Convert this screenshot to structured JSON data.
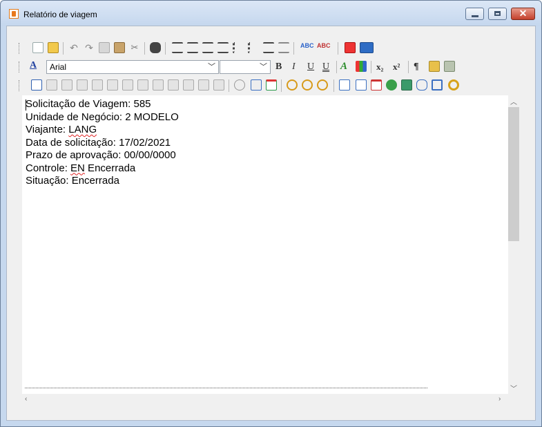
{
  "window": {
    "title": "Relatório de viagem"
  },
  "toolbar": {
    "font_name": "Arial",
    "font_size": "",
    "bold_label": "B",
    "italic_label": "I",
    "underline_label": "U",
    "double_underline_label": "U",
    "subscript_label": "x₂",
    "superscript_label": "x²",
    "paragraph_label": "¶"
  },
  "document": {
    "lines": [
      "Solicitação de Viagem: 585",
      "Unidade de Negócio: 2 MODELO",
      "Viajante: LANG",
      "Data de solicitação: 17/02/2021",
      "Prazo de aprovação: 00/00/0000",
      "Controle: EN Encerrada",
      "Situação: Encerrada"
    ],
    "viajante_label": "Viajante: ",
    "viajante_value": "LANG",
    "controle_label": "Controle: ",
    "controle_code": "EN",
    "controle_status": " Encerrada"
  },
  "colors": {
    "title_gradient_top": "#dbe7f6",
    "close_button": "#c4402b",
    "spellcheck_underline": "#e02020"
  }
}
